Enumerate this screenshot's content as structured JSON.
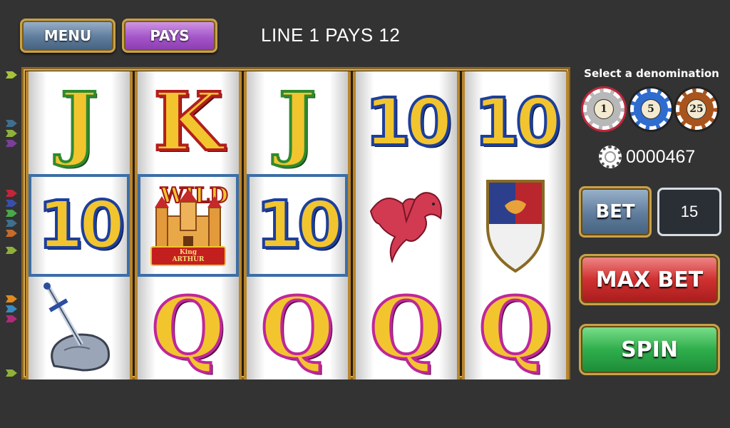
{
  "header": {
    "menu_label": "MENU",
    "pays_label": "PAYS",
    "line_message": "LINE 1 PAYS 12"
  },
  "paylines": {
    "marker_colors": [
      "#a6c23a",
      "#3f6e8e",
      "#8fb03a",
      "#7a3e9a",
      "#c0263a",
      "#3a4fa8",
      "#4aa84a",
      "#3f6e8e",
      "#c86a2a",
      "#8fb03a",
      "#e08a1e",
      "#3a8ac0",
      "#b02a7a",
      "#8fb03a"
    ]
  },
  "reels": [
    {
      "symbols": [
        {
          "text": "J",
          "kind": "J"
        },
        {
          "text": "10",
          "kind": "10",
          "win": true
        },
        {
          "text": "",
          "kind": "sword-in-stone"
        }
      ]
    },
    {
      "symbols": [
        {
          "text": "K",
          "kind": "K"
        },
        {
          "text": "",
          "kind": "wild",
          "win": true
        },
        {
          "text": "Q",
          "kind": "Q"
        }
      ]
    },
    {
      "symbols": [
        {
          "text": "J",
          "kind": "J"
        },
        {
          "text": "10",
          "kind": "10",
          "win": true
        },
        {
          "text": "Q",
          "kind": "Q"
        }
      ]
    },
    {
      "symbols": [
        {
          "text": "10",
          "kind": "10"
        },
        {
          "text": "",
          "kind": "dragon"
        },
        {
          "text": "Q",
          "kind": "Q"
        }
      ]
    },
    {
      "symbols": [
        {
          "text": "10",
          "kind": "10"
        },
        {
          "text": "",
          "kind": "shield"
        },
        {
          "text": "Q",
          "kind": "Q"
        }
      ]
    }
  ],
  "wild_symbol": {
    "word": "WILD",
    "banner_top": "King",
    "banner_bottom": "ARTHUR"
  },
  "panel": {
    "denomination_title": "Select a denomination",
    "denominations": [
      "1",
      "5",
      "25"
    ],
    "selected_denomination": "1",
    "credits": "0000467",
    "bet_label": "BET",
    "bet_value": "15",
    "max_bet_label": "MAX BET",
    "spin_label": "SPIN"
  },
  "colors": {
    "background": "#333333",
    "win_outline": "#3b6ea8",
    "gold": "#f2c52e"
  }
}
